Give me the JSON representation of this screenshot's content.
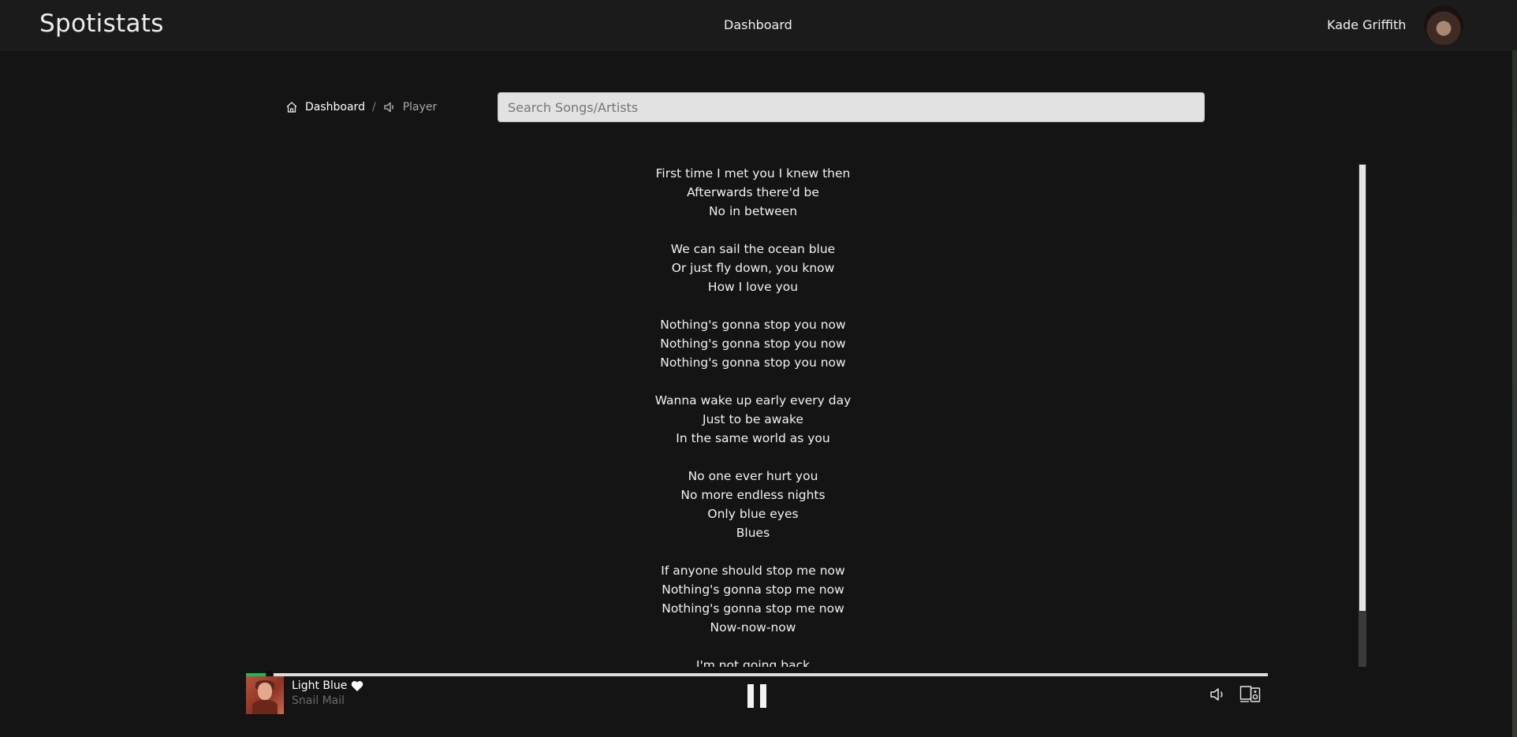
{
  "header": {
    "brand": "Spotistats",
    "nav_dashboard": "Dashboard",
    "user_name": "Kade Griffith",
    "avatar_icon": "user-avatar"
  },
  "breadcrumb": {
    "home_icon": "home-icon",
    "dashboard": "Dashboard",
    "separator": "/",
    "player_icon": "speaker-icon",
    "player": "Player"
  },
  "search": {
    "placeholder": "Search Songs/Artists",
    "value": ""
  },
  "lyrics": [
    "First time I met you I knew then",
    "Afterwards there'd be",
    "No in between",
    "",
    "We can sail the ocean blue",
    "Or just fly down, you know",
    "How I love you",
    "",
    "Nothing's gonna stop you now",
    "Nothing's gonna stop you now",
    "Nothing's gonna stop you now",
    "",
    "Wanna wake up early every day",
    "Just to be awake",
    "In the same world as you",
    "",
    "No one ever hurt you",
    "No more endless nights",
    "Only blue eyes",
    "Blues",
    "",
    "If anyone should stop me now",
    "Nothing's gonna stop me now",
    "Nothing's gonna stop me now",
    "Now-now-now",
    "",
    "I'm not going back"
  ],
  "lyrics_scroll_position": 0.89,
  "player": {
    "track_title": "Light Blue",
    "track_artist": "Snail Mail",
    "liked": true,
    "progress": 0.02,
    "colors": {
      "progress_fill": "#1db954",
      "progress_track": "#dcdcdc"
    },
    "icons": {
      "play_pause": "pause-icon",
      "like": "heart-icon",
      "volume": "volume-icon",
      "devices": "devices-icon"
    }
  }
}
